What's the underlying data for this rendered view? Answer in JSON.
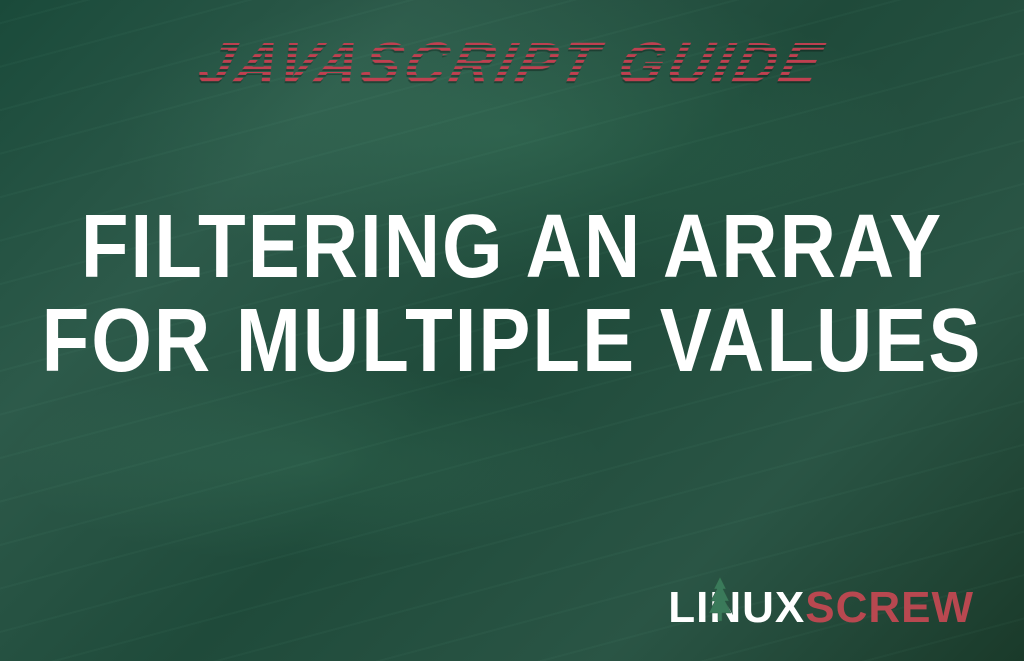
{
  "subtitle": "JAVASCRIPT GUIDE",
  "title": "FILTERING AN ARRAY FOR MULTIPLE VALUES",
  "logo": {
    "part1": "LINUX",
    "part2": "SCREW"
  }
}
